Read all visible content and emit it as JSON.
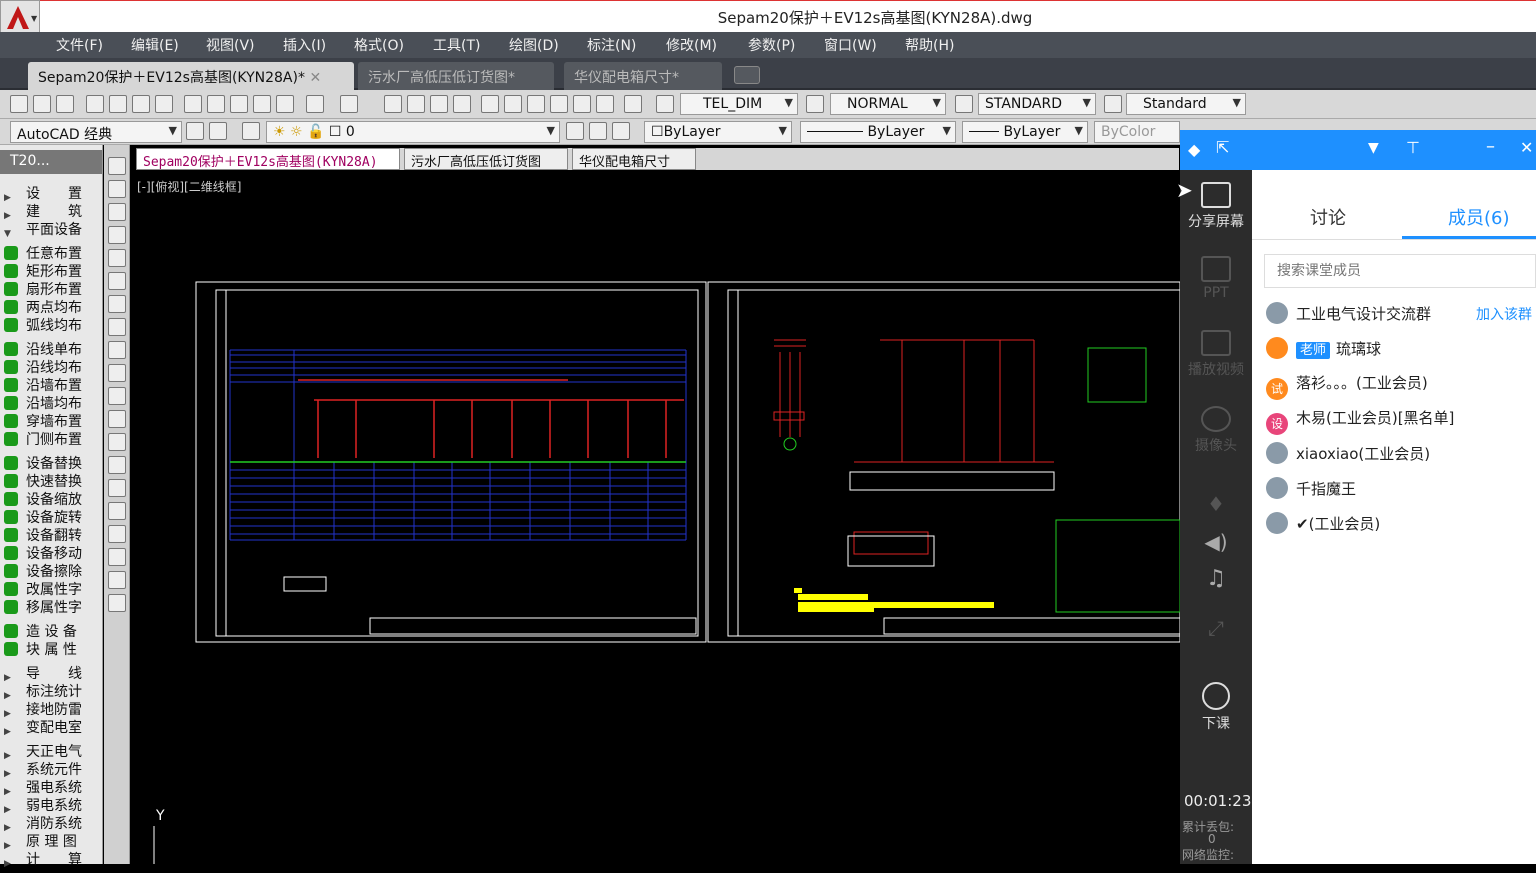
{
  "window": {
    "title": "Sepam20保护＋EV12s高基图(KYN28A).dwg"
  },
  "menu": [
    "文件(F)",
    "编辑(E)",
    "视图(V)",
    "插入(I)",
    "格式(O)",
    "工具(T)",
    "绘图(D)",
    "标注(N)",
    "修改(M)",
    "参数(P)",
    "窗口(W)",
    "帮助(H)"
  ],
  "doc_tabs": [
    "Sepam20保护＋EV12s高基图(KYN28A)*",
    "污水厂高低压低订货图*",
    "华仪配电箱尺寸*"
  ],
  "toolbar": {
    "dim_style": "TEL_DIM",
    "text_style": "NORMAL",
    "table_style": "STANDARD",
    "ml_style": "Standard",
    "workspace": "AutoCAD 经典",
    "layer": "0",
    "color": "ByLayer",
    "linetype": "ByLayer",
    "lineweight": "ByLayer",
    "plotstyle": "ByColor"
  },
  "left_panel": {
    "header": "T20...",
    "items": [
      "设　　置",
      "建　　筑",
      "平面设备",
      "任意布置",
      "矩形布置",
      "扇形布置",
      "两点均布",
      "弧线均布",
      "沿线单布",
      "沿线均布",
      "沿墙布置",
      "沿墙均布",
      "穿墙布置",
      "门侧布置",
      "设备替换",
      "快速替换",
      "设备缩放",
      "设备旋转",
      "设备翻转",
      "设备移动",
      "设备擦除",
      "改属性字",
      "移属性字",
      "造 设 备",
      "块 属 性",
      "导　　线",
      "标注统计",
      "接地防雷",
      "变配电室",
      "天正电气",
      "系统元件",
      "强电系统",
      "弱电系统",
      "消防系统",
      "原 理 图",
      "计　　算"
    ]
  },
  "layout_tabs": [
    "Sepam20保护＋EV12s高基图(KYN28A)",
    "污水厂高低压低订货图",
    "华仪配电箱尺寸"
  ],
  "view_label": "[-][俯视][二维线框]",
  "axis_label": "Y",
  "classroom": {
    "side": [
      "分享屏幕",
      "PPT",
      "播放视频",
      "摄像头",
      "下课"
    ],
    "tabs": [
      "讨论",
      "成员(6)"
    ],
    "search_placeholder": "搜索课堂成员",
    "join_label": "加入该群",
    "members": [
      {
        "name": "工业电气设计交流群",
        "badge": ""
      },
      {
        "name": "琉璃球",
        "badge": "老师"
      },
      {
        "name": "落衫。。。(工业会员)",
        "badge": "试"
      },
      {
        "name": "木易(工业会员)[黑名单]",
        "badge": "设"
      },
      {
        "name": "xiaoxiao(工业会员)",
        "badge": ""
      },
      {
        "name": "千指魔王",
        "badge": ""
      },
      {
        "name": "✔(工业会员)",
        "badge": ""
      }
    ],
    "timer": "00:01:23",
    "stat1_label": "累计丢包:",
    "stat1_value": "0",
    "stat2_label": "网络监控:",
    "colors": {
      "accent": "#1e90ff",
      "side_bg": "#2c2c2c"
    }
  }
}
